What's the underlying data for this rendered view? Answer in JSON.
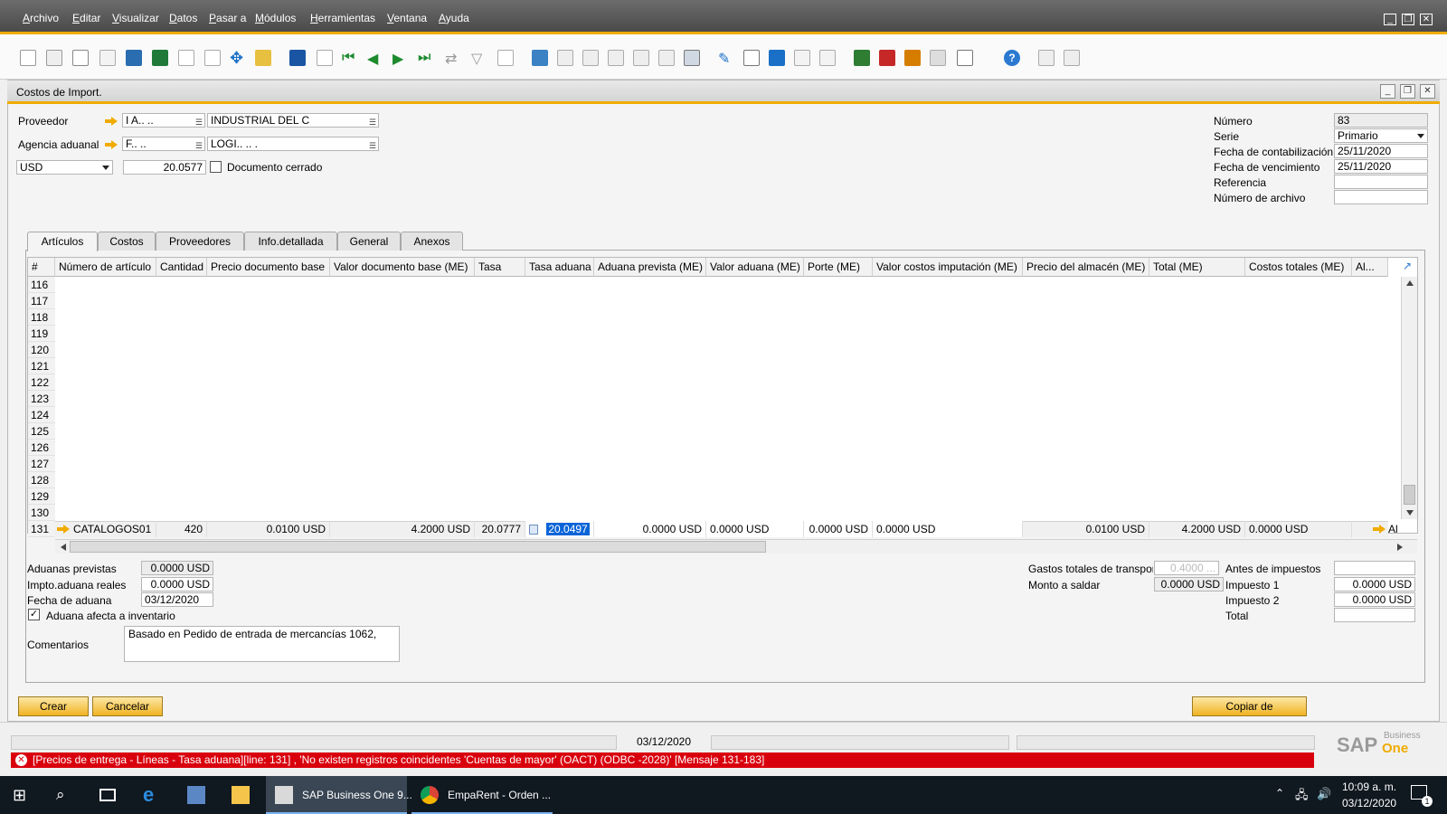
{
  "menu": [
    "Archivo",
    "Editar",
    "Visualizar",
    "Datos",
    "Pasar a",
    "Módulos",
    "Herramientas",
    "Ventana",
    "Ayuda"
  ],
  "doc_title": "Costos de Import.",
  "header": {
    "proveedor_label": "Proveedor",
    "proveedor_code": "I A.. ..",
    "proveedor_name": "INDUSTRIAL DEL C",
    "agencia_label": "Agencia aduanal",
    "agencia_code": "F.. ..",
    "agencia_name": "LOGI.. .. .",
    "currency": "USD",
    "rate": "20.0577",
    "doc_closed_label": "Documento cerrado"
  },
  "right_fields": [
    {
      "label": "Número",
      "value": "83"
    },
    {
      "label": "Serie",
      "value": "Primario"
    },
    {
      "label": "Fecha de contabilización",
      "value": "25/11/2020"
    },
    {
      "label": "Fecha de vencimiento",
      "value": "25/11/2020"
    },
    {
      "label": "Referencia",
      "value": ""
    },
    {
      "label": "Número de archivo",
      "value": ""
    }
  ],
  "tabs": [
    "Artículos",
    "Costos",
    "Proveedores",
    "Info.detallada",
    "General",
    "Anexos"
  ],
  "grid": {
    "headers": [
      "#",
      "Número de artículo",
      "Cantidad",
      "Precio documento base",
      "Valor documento base (ME)",
      "Tasa",
      "Tasa aduana",
      "Aduana prevista (ME)",
      "Valor aduana (ME)",
      "Porte (ME)",
      "Valor costos imputación (ME)",
      "Precio del almacén (ME)",
      "Total (ME)",
      "Costos totales (ME)",
      "Al..."
    ],
    "empty_rows": [
      "116",
      "117",
      "118",
      "119",
      "120",
      "121",
      "122",
      "123",
      "124",
      "125",
      "126",
      "127",
      "128",
      "129",
      "130"
    ],
    "data_row": {
      "num": "131",
      "item": "CATALOGOS01",
      "qty": "420",
      "price": "0.0100 USD",
      "base_value": "4.2000 USD",
      "rate": "20.0777",
      "customs_rate": "20.0497",
      "customs_planned": "0.0000 USD",
      "customs_value": "0.0000 USD",
      "freight": "0.0000 USD",
      "cost_alloc": "0.0000 USD",
      "warehouse_price": "0.0100 USD",
      "total": "4.2000 USD",
      "total_costs": "0.0000 USD",
      "al": "Al"
    }
  },
  "bottom_left": {
    "aduanas_prev_label": "Aduanas previstas",
    "aduanas_prev_value": "0.0000 USD",
    "impto_label": "Impto.aduana reales",
    "impto_value": "0.0000 USD",
    "fecha_label": "Fecha de aduana",
    "fecha_value": "03/12/2020",
    "afecta_label": "Aduana afecta a inventario",
    "comentarios_label": "Comentarios",
    "comentarios_value": "Basado en Pedido de entrada de mercancías 1062,"
  },
  "bottom_right": {
    "gastos_label": "Gastos totales de transporte",
    "gastos_value": "0.4000 ...",
    "monto_label": "Monto a saldar",
    "monto_value": "0.0000 USD",
    "antes_label": "Antes de impuestos",
    "antes_value": "",
    "imp1_label": "Impuesto 1",
    "imp1_value": "0.0000 USD",
    "imp2_label": "Impuesto 2",
    "imp2_value": "0.0000 USD",
    "total_label": "Total",
    "total_value": ""
  },
  "buttons": {
    "crear": "Crear",
    "cancelar": "Cancelar",
    "copiar": "Copiar de"
  },
  "status": {
    "date": "03/12/2020",
    "error": "[Precios de entrega - Líneas - Tasa aduana][line: 131] , 'No existen registros coincidentes  'Cuentas de mayor' (OACT) (ODBC -2028)'  [Mensaje 131-183]",
    "brand_sap": "SAP",
    "brand_business": "Business",
    "brand_one": "One"
  },
  "taskbar": {
    "app1": "SAP Business One 9...",
    "app2": "EmpaRent - Orden ...",
    "time": "10:09 a. m.",
    "date": "03/12/2020",
    "notif": "1"
  },
  "colors": {
    "accent": "#f0ab00",
    "error": "#d9000d",
    "selection": "#0a64d8"
  }
}
